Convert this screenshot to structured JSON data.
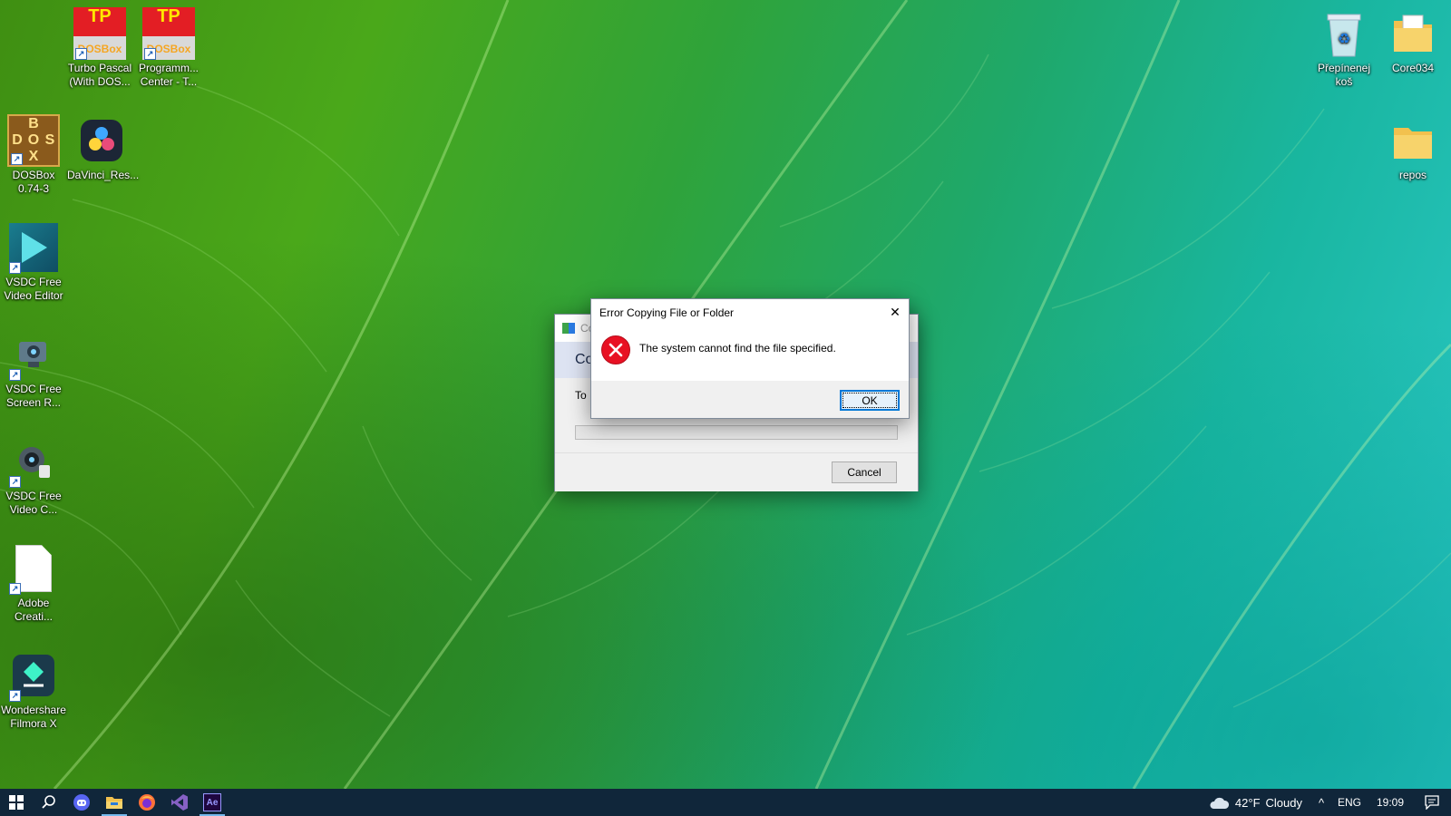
{
  "desktop": {
    "icons_left": [
      {
        "label": "Turbo Pascal\n(With DOS...",
        "icon": "turbo-pascal-icon"
      },
      {
        "label": "Programm...\nCenter -  T...",
        "icon": "turbo-pascal-icon"
      },
      {
        "label": "DOSBox\n0.74-3",
        "icon": "dosbox-icon"
      },
      {
        "label": "DaVinci_Res...",
        "icon": "davinci-resolve-icon"
      },
      {
        "label": "VSDC Free\nVideo Editor",
        "icon": "vsdc-editor-icon"
      },
      {
        "label": "VSDC Free\nScreen R...",
        "icon": "vsdc-screen-recorder-icon"
      },
      {
        "label": "VSDC Free\nVideo C...",
        "icon": "vsdc-video-capture-icon"
      },
      {
        "label": "Adobe\nCreati...",
        "icon": "blank-file-icon"
      },
      {
        "label": "Wondershare\nFilmora X",
        "icon": "filmora-icon"
      }
    ],
    "icons_right": [
      {
        "label": "Přepínenej\nkoš",
        "icon": "recycle-bin-icon"
      },
      {
        "label": "Core034",
        "icon": "folder-icon"
      },
      {
        "label": "repos",
        "icon": "folder-icon"
      }
    ],
    "tp_text": "TP",
    "tp_sub": "DOSBox",
    "dosbox_letters": [
      "B",
      "D",
      "O",
      "S",
      "X"
    ]
  },
  "copy_dialog": {
    "title": "Co",
    "heading": "Co",
    "to_label": "To",
    "cancel_label": "Cancel"
  },
  "error_dialog": {
    "title": "Error Copying File or Folder",
    "message": "The system cannot find the file specified.",
    "ok_label": "OK",
    "close_glyph": "✕"
  },
  "taskbar": {
    "weather_temp": "42°F",
    "weather_desc": "Cloudy",
    "language": "ENG",
    "time": "19:09",
    "chevron_glyph": "^",
    "apps": [
      "windows-start-icon",
      "search-icon",
      "discord-icon",
      "file-explorer-icon",
      "firefox-icon",
      "visual-studio-icon",
      "after-effects-icon"
    ],
    "ae_label": "Ae"
  }
}
